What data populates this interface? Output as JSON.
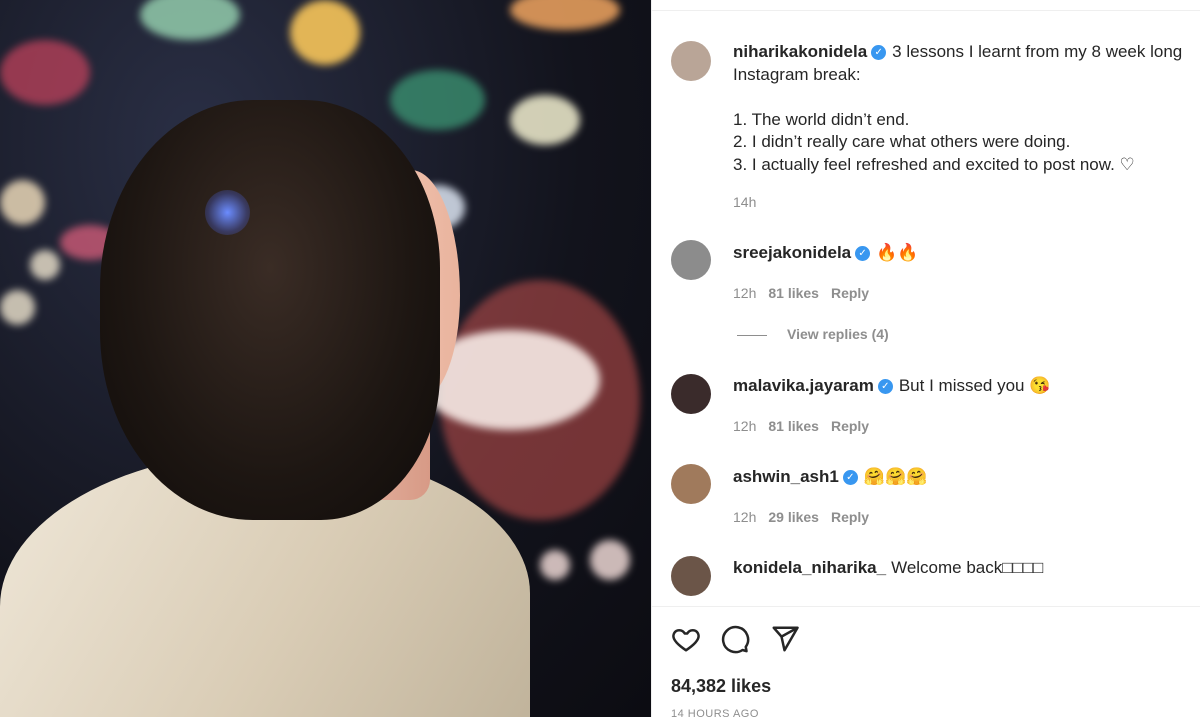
{
  "post": {
    "author": "niharikakonidela",
    "caption_lines": [
      "3 lessons I learnt from my 8 week long",
      "Instagram break:",
      "",
      "1. The world didn’t end.",
      "2. I didn’t really care what others were doing.",
      "3. I actually feel refreshed and excited to post now. ♡"
    ],
    "time": "14h",
    "likes": "84,382 likes",
    "posted_ago": "14 HOURS AGO"
  },
  "comments": [
    {
      "user": "sreejakonidela",
      "text": "🔥🔥",
      "time": "12h",
      "likes": "81 likes",
      "reply": "Reply"
    },
    {
      "user": "malavika.jayaram",
      "text": "But I missed you 😘",
      "time": "12h",
      "likes": "81 likes",
      "reply": "Reply"
    },
    {
      "user": "ashwin_ash1",
      "text": "🤗🤗🤗",
      "time": "12h",
      "likes": "29 likes",
      "reply": "Reply"
    },
    {
      "user": "konidela_niharika_",
      "text": "Welcome back□□□□"
    }
  ],
  "view_replies": "View replies (4)",
  "icons": {
    "like": "heart-icon",
    "comment": "speech-bubble-icon",
    "share": "paper-plane-icon",
    "verified": "verified-badge-icon"
  },
  "colors": {
    "verified": "#3897f0",
    "meta_text": "#8e8e8e",
    "text": "#262626"
  }
}
